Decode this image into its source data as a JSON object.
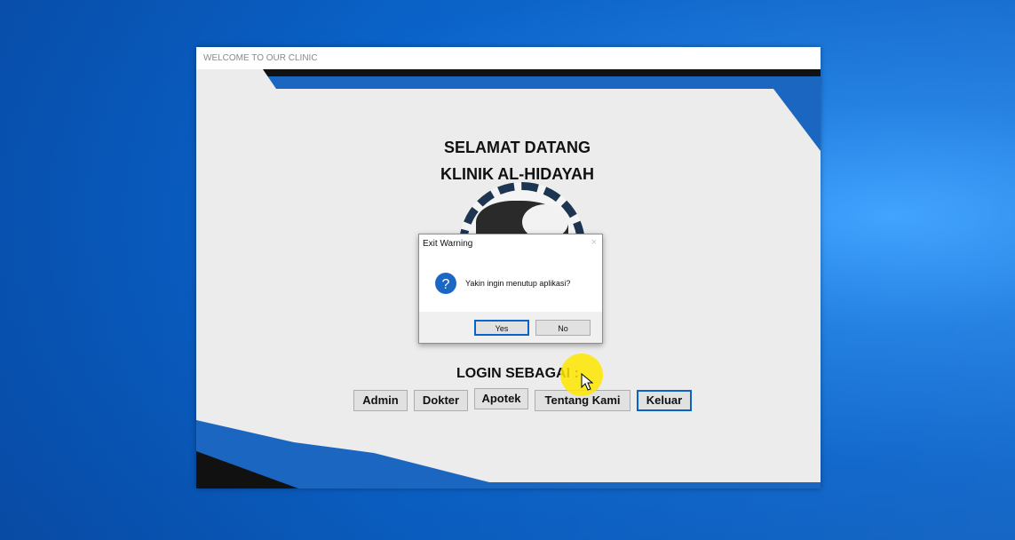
{
  "window": {
    "title": "WELCOME TO OUR CLINIC"
  },
  "main": {
    "heading_line1": "SELAMAT DATANG",
    "heading_line2": "KLINIK AL-HIDAYAH",
    "login_label": "LOGIN SEBAGAI :",
    "buttons": [
      {
        "label": "Admin"
      },
      {
        "label": "Dokter"
      },
      {
        "label": "Apotek"
      },
      {
        "label": "Tentang Kami"
      },
      {
        "label": "Keluar"
      }
    ],
    "logo_icon": "clinic-logo"
  },
  "dialog": {
    "title": "Exit Warning",
    "close_glyph": "×",
    "message": "Yakin ingin menutup aplikasi?",
    "icon": "question-icon",
    "yes_label": "Yes",
    "no_label": "No"
  },
  "colors": {
    "accent_blue": "#0a63c9",
    "dark_band": "#111111",
    "window_bg": "#ececec",
    "desktop_blue": "#0a63c9"
  }
}
